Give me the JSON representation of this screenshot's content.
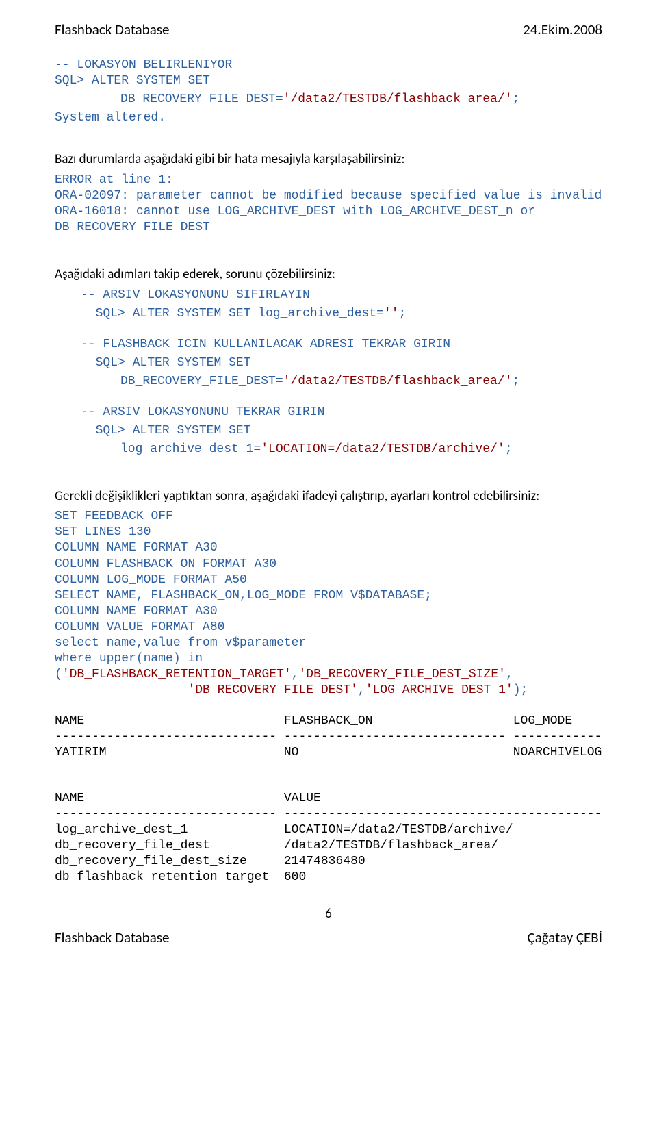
{
  "header": {
    "left": "Flashback Database",
    "right": "24.Ekim.2008"
  },
  "footer": {
    "left": "Flashback Database",
    "right": "Çağatay ÇEBİ",
    "page": "6"
  },
  "c1": {
    "l1": "-- LOKASYON BELIRLENIYOR",
    "l2a": "SQL> ",
    "l2b": "ALTER",
    "l2c": " SYSTEM ",
    "l2d": "SET",
    "l3a": "DB_RECOVERY_FILE_DEST=",
    "l3b": "'/data2/TESTDB/flashback_area/'",
    "l3c": ";",
    "l4a": "System",
    "l4b": " altered."
  },
  "p1": "Bazı durumlarda aşağıdaki gibi bir hata mesajıyla karşılaşabilirsiniz:",
  "err": {
    "l1": "ERROR at line 1:",
    "l2": "ORA-02097: parameter cannot be modified because specified value is invalid",
    "l3": "ORA-16018: cannot use LOG_ARCHIVE_DEST with LOG_ARCHIVE_DEST_n or",
    "l4": "DB_RECOVERY_FILE_DEST"
  },
  "p2": "Aşağıdaki adımları takip ederek, sorunu çözebilirsiniz:",
  "c2": {
    "a1": "-- ARSIV LOKASYONUNU SIFIRLAYIN",
    "a2a": "SQL> ",
    "a2b": "ALTER",
    "a2c": " SYSTEM ",
    "a2d": "SET",
    "a2e": " log_archive_dest=",
    "a2f": "''",
    "a2g": ";",
    "b1": "-- FLASHBACK ICIN KULLANILACAK ADRESI TEKRAR GIRIN",
    "b2a": "SQL> ",
    "b2b": "ALTER",
    "b2c": " SYSTEM ",
    "b2d": "SET",
    "b3a": "DB_RECOVERY_FILE_DEST=",
    "b3b": "'/data2/TESTDB/flashback_area/'",
    "b3c": ";",
    "c1": "-- ARSIV LOKASYONUNU TEKRAR GIRIN",
    "c2a": "SQL> ",
    "c2b": "ALTER",
    "c2c": " SYSTEM ",
    "c2d": "SET",
    "c3a": "log_archive_dest_1=",
    "c3b": "'LOCATION=/data2/TESTDB/archive/'",
    "c3c": ";"
  },
  "p3": "Gerekli değişiklikleri yaptıktan sonra, aşağıdaki ifadeyi çalıştırıp, ayarları kontrol edebilirsiniz:",
  "c3": {
    "l1a": "SET",
    "l1b": " FEEDBACK ",
    "l1c": "OFF",
    "l2a": "SET",
    "l2b": " LINES 130",
    "l3a": "COLUMN",
    "l3b": " NAME ",
    "l3c": "FORMAT",
    "l3d": " A30",
    "l4a": "COLUMN",
    "l4b": " FLASHBACK_ON ",
    "l4c": "FORMAT",
    "l4d": " A30",
    "l5a": "COLUMN",
    "l5b": " LOG_MODE ",
    "l5c": "FORMAT",
    "l5d": " A50",
    "l6a": "SELECT",
    "l6b": " NAME, FLASHBACK_ON,LOG_MODE ",
    "l6c": "FROM",
    "l6d": " V$DATABASE;",
    "l7a": "COLUMN",
    "l7b": " NAME ",
    "l7c": "FORMAT",
    "l7d": " A30",
    "l8a": "COLUMN",
    "l8b": " VALUE ",
    "l8c": "FORMAT",
    "l8d": " A80",
    "l9a": "select",
    "l9b": " name,value ",
    "l9c": "from",
    "l9d": " v$parameter",
    "l10a": "where",
    "l10b": " upper(name) ",
    "l10c": "in",
    "l11a": "(",
    "l11b": "'DB_FLASHBACK_RETENTION_TARGET'",
    "l11c": ",",
    "l11d": "'DB_RECOVERY_FILE_DEST_SIZE'",
    "l11e": ",",
    "l12a": "'DB_RECOVERY_FILE_DEST'",
    "l12b": ",",
    "l12c": "'LOG_ARCHIVE_DEST_1'",
    "l12d": ");"
  },
  "out1": {
    "h": "NAME                           FLASHBACK_ON                   LOG_MODE",
    "d": "------------------------------ ------------------------------ ------------",
    "r": "YATIRIM                        NO                             NOARCHIVELOG"
  },
  "out2": {
    "h": "NAME                           VALUE",
    "d": "------------------------------ -------------------------------------------",
    "r1": "log_archive_dest_1             LOCATION=/data2/TESTDB/archive/",
    "r2": "db_recovery_file_dest          /data2/TESTDB/flashback_area/",
    "r3": "db_recovery_file_dest_size     21474836480",
    "r4": "db_flashback_retention_target  600"
  }
}
